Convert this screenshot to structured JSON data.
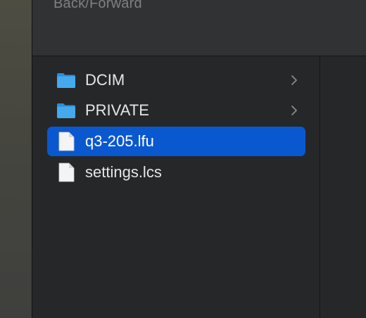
{
  "toolbar": {
    "label": "Back/Forward"
  },
  "items": [
    {
      "label": "DCIM",
      "kind": "folder",
      "has_children": true,
      "selected": false,
      "icon": "folder-icon"
    },
    {
      "label": "PRIVATE",
      "kind": "folder",
      "has_children": true,
      "selected": false,
      "icon": "folder-icon"
    },
    {
      "label": "q3-205.lfu",
      "kind": "file",
      "has_children": false,
      "selected": true,
      "icon": "document-icon"
    },
    {
      "label": "settings.lcs",
      "kind": "file",
      "has_children": false,
      "selected": false,
      "icon": "document-icon"
    }
  ],
  "colors": {
    "selection": "#0a58d0",
    "folder": "#3ea2e6",
    "background": "#262728"
  }
}
